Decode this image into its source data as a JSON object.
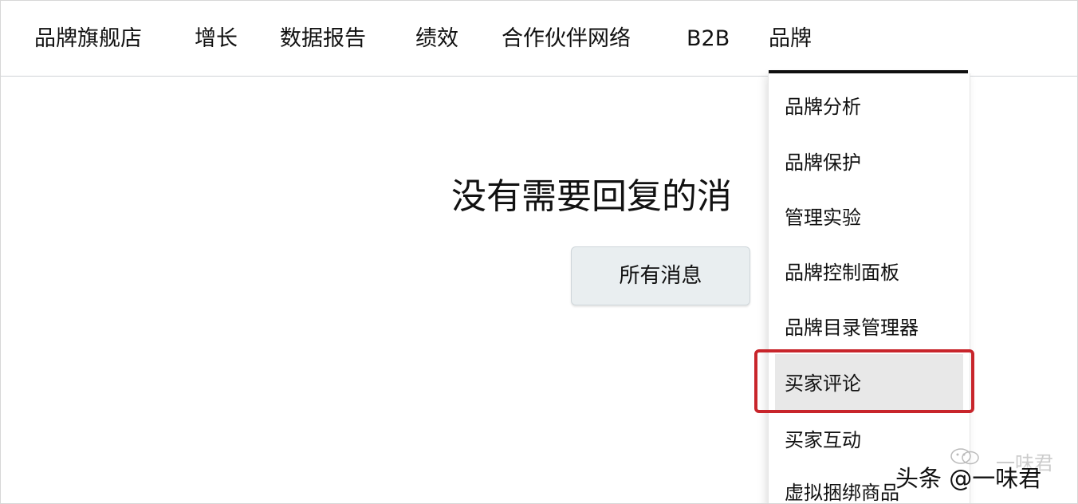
{
  "nav": {
    "items": [
      {
        "label": "品牌旗舰店"
      },
      {
        "label": "增长"
      },
      {
        "label": "数据报告"
      },
      {
        "label": "绩效"
      },
      {
        "label": "合作伙伴网络"
      },
      {
        "label": "B2B"
      },
      {
        "label": "品牌"
      }
    ],
    "active": "品牌"
  },
  "main": {
    "heading": "没有需要回复的消",
    "button_label": "所有消息"
  },
  "dropdown": {
    "items": [
      {
        "label": "品牌分析"
      },
      {
        "label": "品牌保护"
      },
      {
        "label": "管理实验"
      },
      {
        "label": "品牌控制面板"
      },
      {
        "label": "品牌目录管理器"
      },
      {
        "label": "买家评论"
      },
      {
        "label": "买家互动"
      },
      {
        "label": "虚拟捆绑商品"
      }
    ],
    "selected": "买家评论"
  },
  "watermark": {
    "text": "头条 @一味君",
    "faint_text": "一味君",
    "icon": "wechat-icon"
  },
  "colors": {
    "highlight": "#c8252b",
    "nav_underline": "#111111",
    "selected_bg": "#e8e8e8",
    "button_bg": "#e9eef0"
  }
}
